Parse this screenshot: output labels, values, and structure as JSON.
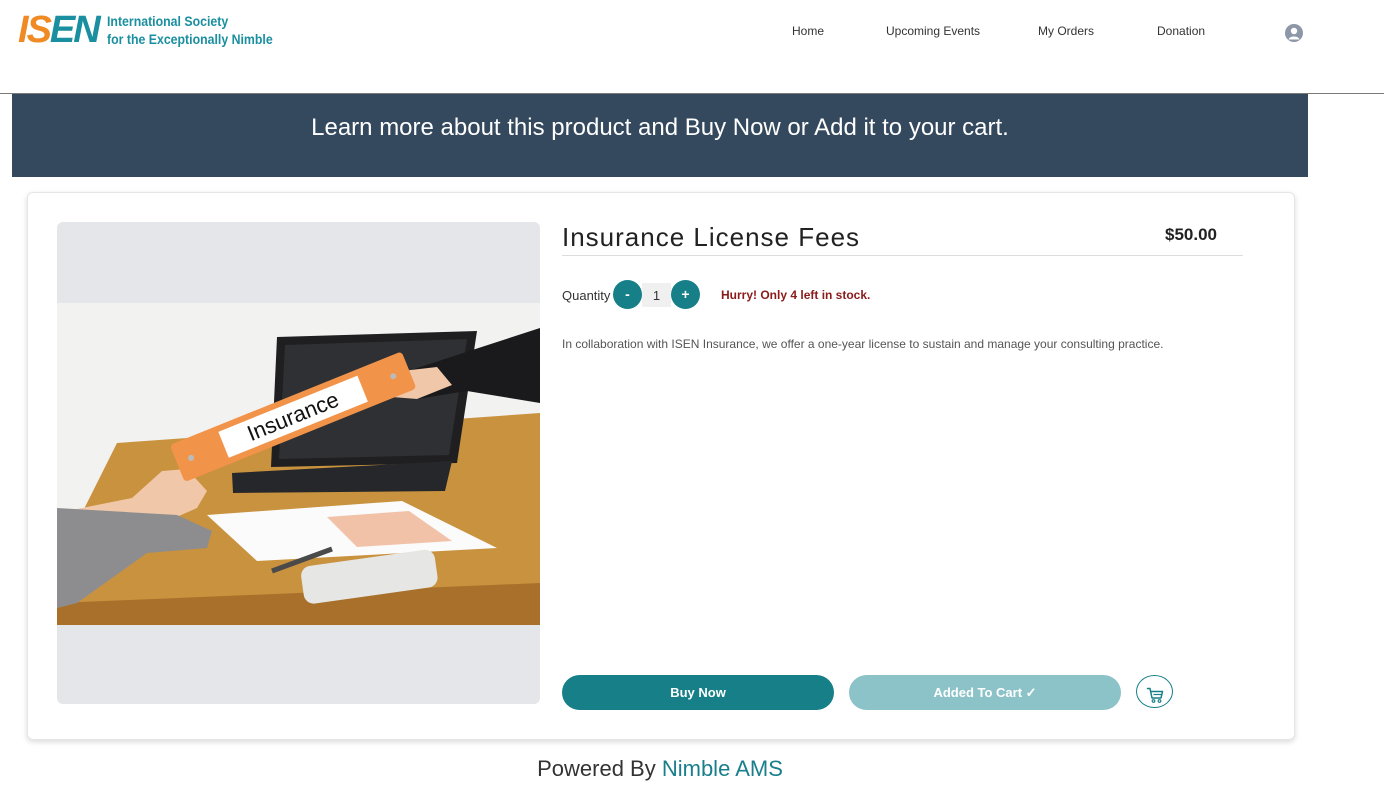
{
  "header": {
    "logo_mark": [
      "I",
      "S",
      "E",
      "N"
    ],
    "logo_line1": "International Society",
    "logo_line2": "for the Exceptionally Nimble",
    "nav": {
      "home": "Home",
      "events": "Upcoming Events",
      "orders": "My Orders",
      "donation": "Donation"
    },
    "avatar_icon": "user-avatar-icon"
  },
  "banner": {
    "text": "Learn more about this product and Buy Now or  Add it to your cart."
  },
  "product": {
    "title": "Insurance License Fees",
    "price": "$50.00",
    "image_label": "Insurance",
    "quantity_label": "Quantity",
    "quantity_value": "1",
    "minus_label": "-",
    "plus_label": "+",
    "stock_message": "Hurry! Only 4 left in stock.",
    "description": "In collaboration with ISEN Insurance, we offer a one-year license to sustain and manage your consulting practice.",
    "buy_now_label": "Buy Now",
    "added_to_cart_label": "Added To Cart ✓",
    "cart_icon": "cart-icon"
  },
  "footer": {
    "powered_by": "Powered By",
    "brand": "Nimble AMS"
  },
  "colors": {
    "banner_bg": "#34495e",
    "primary": "#167f87",
    "primary_light": "#8cc3c8",
    "logo_orange": "#f08a24",
    "logo_teal": "#1a8fa0",
    "stock_red": "#8b1a1a"
  }
}
